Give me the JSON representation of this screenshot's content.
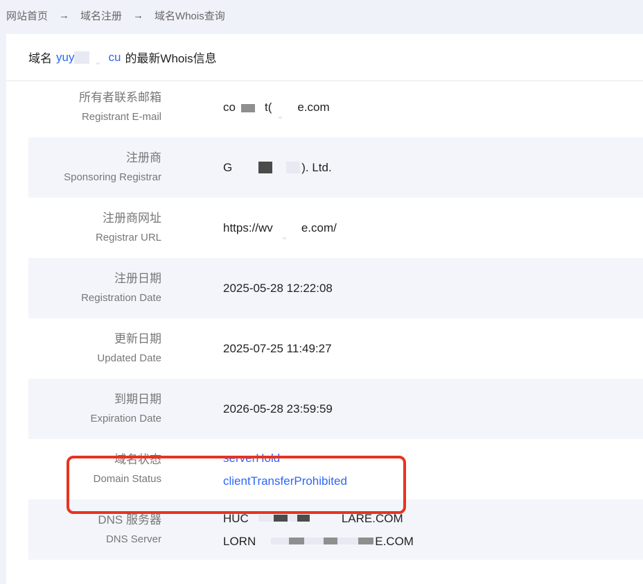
{
  "breadcrumb": {
    "home": "网站首页",
    "separator": "→",
    "domain_register": "域名注册",
    "whois_query": "域名Whois查询"
  },
  "header": {
    "prefix": "域名",
    "domain_start": "yuy",
    "domain_end": "cu",
    "suffix": "的最新Whois信息"
  },
  "records": {
    "registrant_email": {
      "label_zh": "所有者联系邮箱",
      "label_en": "Registrant E-mail",
      "value_a": "co",
      "value_b": "t(",
      "value_c": "e.com"
    },
    "sponsoring_registrar": {
      "label_zh": "注册商",
      "label_en": "Sponsoring Registrar",
      "value_a": "G",
      "value_b": "). Ltd."
    },
    "registrar_url": {
      "label_zh": "注册商网址",
      "label_en": "Registrar URL",
      "value_a": "https://wv",
      "value_b": "e.com/"
    },
    "registration_date": {
      "label_zh": "注册日期",
      "label_en": "Registration Date",
      "value": "2025-05-28 12:22:08"
    },
    "updated_date": {
      "label_zh": "更新日期",
      "label_en": "Updated Date",
      "value": "2025-07-25 11:49:27"
    },
    "expiration_date": {
      "label_zh": "到期日期",
      "label_en": "Expiration Date",
      "value": "2026-05-28 23:59:59"
    },
    "domain_status": {
      "label_zh": "域名状态",
      "label_en": "Domain Status",
      "statuses": [
        "serverHold",
        "clientTransferProhibited"
      ]
    },
    "dns_server": {
      "label_zh": "DNS 服务器",
      "label_en": "DNS Server",
      "ns1_a": "HUC",
      "ns1_b": "LARE.COM",
      "ns2_a": "LORN",
      "ns2_b": "E.COM"
    }
  },
  "colors": {
    "accent_link": "#2d66f5",
    "highlight_border": "#e8331d",
    "alt_row": "#f3f5fb",
    "page_background": "#f0f2f9"
  },
  "icons": {
    "breadcrumb_separator": "arrow-right-icon"
  }
}
